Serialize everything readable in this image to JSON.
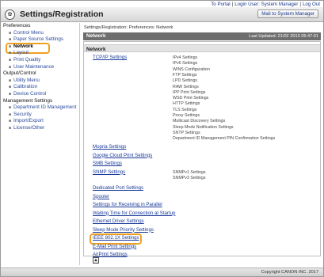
{
  "toplinks": {
    "portal": "To Portal",
    "login_label": "Login User: System Manager",
    "logout": "Log Out"
  },
  "header": {
    "title": "Settings/Registration",
    "logo_glyph": "✿",
    "mail_button": "Mail to System Manager"
  },
  "sidebar": {
    "groups": [
      {
        "label": "Preferences",
        "items": [
          "Control Menu",
          "Paper Source Settings",
          "Network",
          "Layout",
          "Print Quality",
          "User Maintenance"
        ]
      },
      {
        "label": "Output/Control",
        "items": [
          "Utility Menu",
          "Calibration",
          "Device Control"
        ]
      },
      {
        "label": "Management Settings",
        "items": [
          "Department ID Management",
          "Security",
          "Import/Export",
          "License/Other"
        ]
      }
    ],
    "active_item": "Network"
  },
  "main": {
    "breadcrumb": "Settings/Registration: Preferences: Network",
    "title": "Network",
    "last_updated": "Last Updated: 21/02 2013 05:47:01",
    "section": "Network",
    "tcpip": {
      "label": "TCP/IP Settings",
      "sub": [
        "IPv4 Settings",
        "IPv6 Settings",
        "WINS Configuration",
        "FTP Settings",
        "LPD Settings",
        "RAW Settings",
        "IPP Print Settings",
        "WSD Print Settings",
        "HTTP Settings",
        "TLS Settings",
        "Proxy Settings",
        "Multicast Discovery Settings",
        "Sleep Mode Notification Settings",
        "SNTP Settings",
        "Department ID Management PIN Confirmation Settings"
      ]
    },
    "links_a": [
      "Mopria Settings",
      "Google Cloud Print Settings",
      "SMB Settings"
    ],
    "snmp": {
      "label": "SNMP Settings",
      "sub": [
        "SNMPv1 Settings",
        "SNMPv3 Settings"
      ]
    },
    "links_b": [
      "Dedicated Port Settings",
      "Spooler",
      "Settings for Receiving in Parallel",
      "Waiting Time for Connection at Startup",
      "Ethernet Driver Settings",
      "Sleep Mode Priority Settings",
      "IEEE 802.1X Settings",
      "E-Mail Print Settings",
      "AirPrint Settings"
    ],
    "highlighted_link": "IEEE 802.1X Settings",
    "top_button": "▲"
  },
  "footer": {
    "copyright": "Copyright CANON INC. 2017"
  }
}
